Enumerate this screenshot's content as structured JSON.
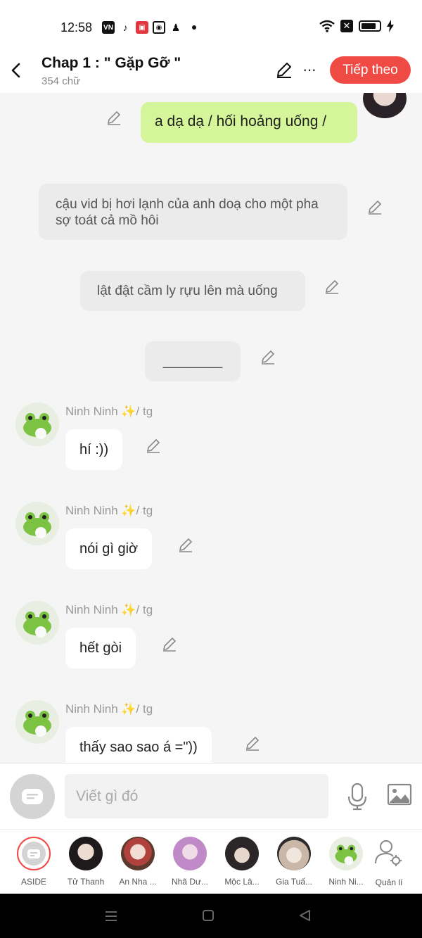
{
  "status_bar": {
    "time": "12:58",
    "app_icons": [
      "vn-icon",
      "tiktok-icon",
      "app-icon",
      "instagram-icon",
      "people-icon"
    ],
    "right_icons": [
      "wifi-icon",
      "close-box-icon",
      "battery-icon",
      "charging-icon"
    ]
  },
  "header": {
    "title": "Chap 1 : \" Gặp Gỡ \"",
    "word_count": "354 chữ",
    "next_label": "Tiếp theo",
    "more_label": "···"
  },
  "chat": {
    "right_message": "a dạ dạ / hối hoảng uống /",
    "narrations": [
      "cậu vid bị hơi lạnh của anh doạ cho một pha sợ toát cả mồ hôi",
      "lật đật cầm ly rựu lên mà uống",
      "________"
    ],
    "messages": [
      {
        "name": "Ninh Ninh ✨/ tg",
        "text": "hí :))"
      },
      {
        "name": "Ninh Ninh ✨/ tg",
        "text": "nói gì giờ"
      },
      {
        "name": "Ninh Ninh ✨/ tg",
        "text": "hết gòi"
      },
      {
        "name": "Ninh Ninh ✨/ tg",
        "text": "thấy sao sao á =\"))"
      }
    ]
  },
  "input": {
    "placeholder": "Viết gì đó"
  },
  "characters": [
    {
      "label": "ASIDE"
    },
    {
      "label": "Tử Thanh"
    },
    {
      "label": "An Nha ..."
    },
    {
      "label": "Nhã Dư..."
    },
    {
      "label": "Mộc Lâ..."
    },
    {
      "label": "Gia Tuấ..."
    },
    {
      "label": "Ninh Ni..."
    },
    {
      "label": "Quản lí"
    }
  ],
  "colors": {
    "accent": "#f04a44",
    "right_bubble": "#d4f59a",
    "narration": "#ebebeb",
    "background": "#f5f5f5"
  }
}
